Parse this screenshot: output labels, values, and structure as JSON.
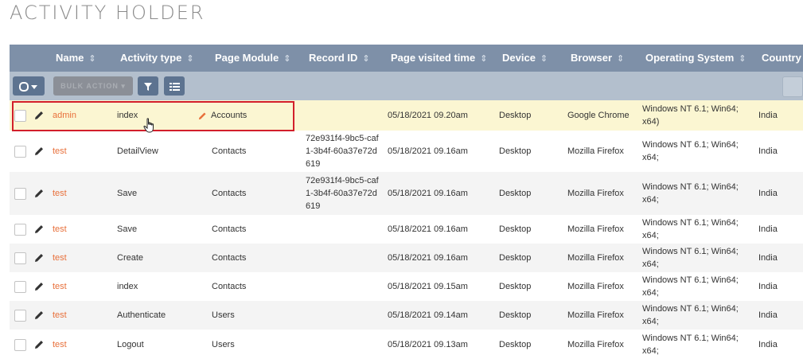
{
  "page": {
    "title": "ACTIVITY HOLDER"
  },
  "columns": [
    {
      "key": "name",
      "label": "Name"
    },
    {
      "key": "activity_type",
      "label": "Activity type"
    },
    {
      "key": "page_module",
      "label": "Page Module"
    },
    {
      "key": "record_id",
      "label": "Record ID"
    },
    {
      "key": "page_visited_time",
      "label": "Page visited time"
    },
    {
      "key": "device",
      "label": "Device"
    },
    {
      "key": "browser",
      "label": "Browser"
    },
    {
      "key": "operating_system",
      "label": "Operating System"
    },
    {
      "key": "country",
      "label": "Country"
    }
  ],
  "toolbar": {
    "bulk_action_label": "BULK ACTION ▾",
    "select_icon": "checkbox-dropdown-icon",
    "filter_icon": "filter-icon",
    "columns_icon": "list-columns-icon"
  },
  "colors": {
    "header_bg": "#7e90a8",
    "toolbar_bg": "#b3bfcd",
    "name_link": "#e8703b",
    "highlight_row": "#fbf6d2",
    "selection_border": "#d21f2b"
  },
  "rows": [
    {
      "name": "admin",
      "activity_type": "index",
      "page_module": "Accounts",
      "record_id": "",
      "page_visited_time": "05/18/2021 09.20am",
      "device": "Desktop",
      "browser": "Google Chrome",
      "operating_system": "Windows NT 6.1; Win64; x64)",
      "country": "India"
    },
    {
      "name": "test",
      "activity_type": "DetailView",
      "page_module": "Contacts",
      "record_id": "72e931f4-9bc5-caf1-3b4f-60a37e72d619",
      "page_visited_time": "05/18/2021 09.16am",
      "device": "Desktop",
      "browser": "Mozilla Firefox",
      "operating_system": "Windows NT 6.1; Win64; x64;",
      "country": "India"
    },
    {
      "name": "test",
      "activity_type": "Save",
      "page_module": "Contacts",
      "record_id": "72e931f4-9bc5-caf1-3b4f-60a37e72d619",
      "page_visited_time": "05/18/2021 09.16am",
      "device": "Desktop",
      "browser": "Mozilla Firefox",
      "operating_system": "Windows NT 6.1; Win64; x64;",
      "country": "India"
    },
    {
      "name": "test",
      "activity_type": "Save",
      "page_module": "Contacts",
      "record_id": "",
      "page_visited_time": "05/18/2021 09.16am",
      "device": "Desktop",
      "browser": "Mozilla Firefox",
      "operating_system": "Windows NT 6.1; Win64; x64;",
      "country": "India"
    },
    {
      "name": "test",
      "activity_type": "Create",
      "page_module": "Contacts",
      "record_id": "",
      "page_visited_time": "05/18/2021 09.16am",
      "device": "Desktop",
      "browser": "Mozilla Firefox",
      "operating_system": "Windows NT 6.1; Win64; x64;",
      "country": "India"
    },
    {
      "name": "test",
      "activity_type": "index",
      "page_module": "Contacts",
      "record_id": "",
      "page_visited_time": "05/18/2021 09.15am",
      "device": "Desktop",
      "browser": "Mozilla Firefox",
      "operating_system": "Windows NT 6.1; Win64; x64;",
      "country": "India"
    },
    {
      "name": "test",
      "activity_type": "Authenticate",
      "page_module": "Users",
      "record_id": "",
      "page_visited_time": "05/18/2021 09.14am",
      "device": "Desktop",
      "browser": "Mozilla Firefox",
      "operating_system": "Windows NT 6.1; Win64; x64;",
      "country": "India"
    },
    {
      "name": "test",
      "activity_type": "Logout",
      "page_module": "Users",
      "record_id": "",
      "page_visited_time": "05/18/2021 09.13am",
      "device": "Desktop",
      "browser": "Mozilla Firefox",
      "operating_system": "Windows NT 6.1; Win64; x64;",
      "country": "India"
    }
  ]
}
